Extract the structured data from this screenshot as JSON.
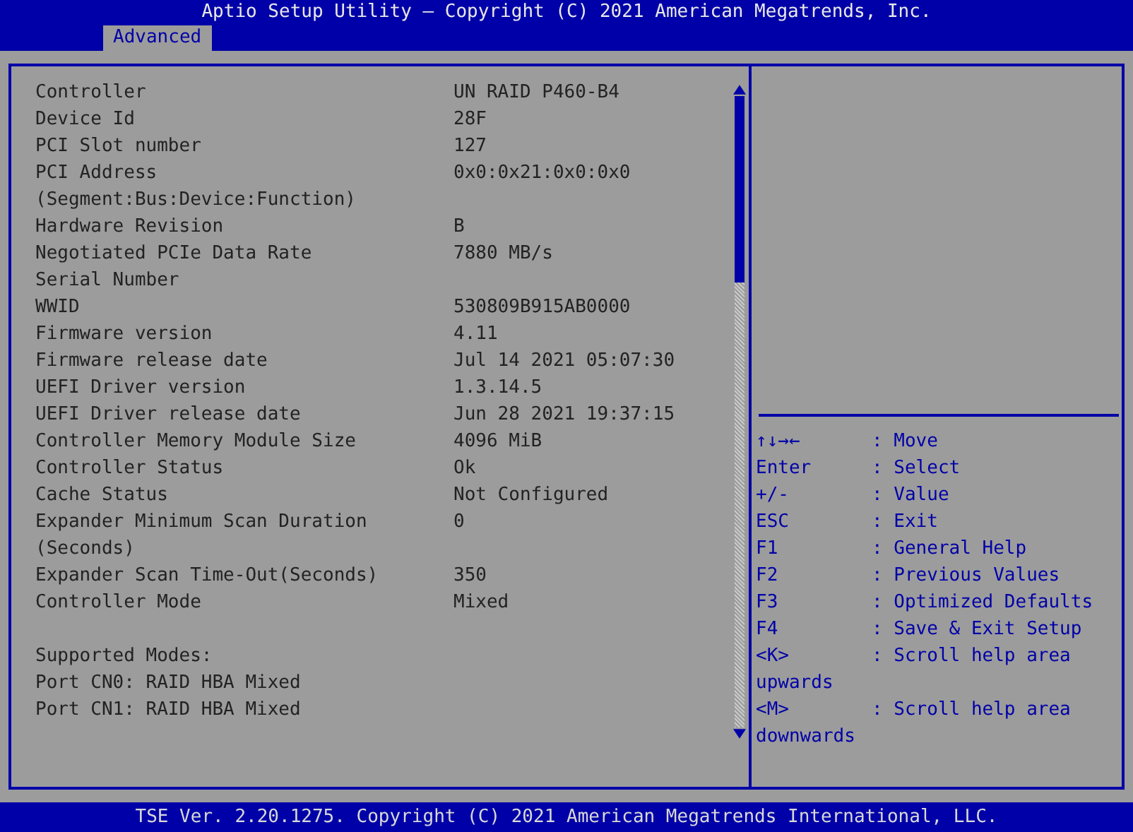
{
  "window": {
    "title": "Aptio Setup Utility – Copyright (C) 2021 American Megatrends, Inc."
  },
  "tabs": [
    {
      "label": "Advanced",
      "selected": true
    }
  ],
  "fields": [
    {
      "label": "Controller",
      "value": "UN RAID P460-B4"
    },
    {
      "label": "Device Id",
      "value": "28F"
    },
    {
      "label": "PCI Slot number",
      "value": "127"
    },
    {
      "label": "PCI Address",
      "value": "0x0:0x21:0x0:0x0"
    },
    {
      "label": "(Segment:Bus:Device:Function)"
    },
    {
      "label": "Hardware Revision",
      "value": "B"
    },
    {
      "label": "Negotiated PCIe Data Rate",
      "value": "7880 MB/s"
    },
    {
      "label": "Serial Number"
    },
    {
      "label": "WWID",
      "value": "530809B915AB0000"
    },
    {
      "label": "Firmware version",
      "value": "4.11"
    },
    {
      "label": "Firmware release date",
      "value": "Jul 14 2021 05:07:30"
    },
    {
      "label": "UEFI Driver version",
      "value": "1.3.14.5"
    },
    {
      "label": "UEFI Driver release date",
      "value": "Jun 28 2021 19:37:15"
    },
    {
      "label": "Controller Memory Module Size",
      "value": "4096 MiB"
    },
    {
      "label": "Controller Status",
      "value": "Ok"
    },
    {
      "label": "Cache Status",
      "value": "Not Configured"
    },
    {
      "label": "Expander Minimum Scan Duration",
      "value": "0"
    },
    {
      "label": "(Seconds)"
    },
    {
      "label": "Expander Scan Time-Out(Seconds)",
      "value": "350"
    },
    {
      "label": "Controller Mode",
      "value": "Mixed"
    }
  ],
  "notes": [
    "Supported Modes:",
    "Port CN0: RAID HBA Mixed",
    "Port CN1: RAID HBA Mixed"
  ],
  "help": [
    {
      "key": "↑↓→←",
      "action": ": Move"
    },
    {
      "key": "Enter",
      "action": ": Select"
    },
    {
      "key": "+/-",
      "action": ": Value"
    },
    {
      "key": "ESC",
      "action": ": Exit"
    },
    {
      "key": "F1",
      "action": ": General Help"
    },
    {
      "key": "F2",
      "action": ": Previous Values"
    },
    {
      "key": "F3",
      "action": ": Optimized Defaults"
    },
    {
      "key": "F4",
      "action": ": Save & Exit Setup"
    },
    {
      "key": "<K>",
      "action": ": Scroll help area",
      "wrap": "upwards"
    },
    {
      "key": "<M>",
      "action": ": Scroll help area",
      "wrap": "downwards"
    }
  ],
  "status_bar": "TSE Ver. 2.20.1275. Copyright (C) 2021 American Megatrends International, LLC."
}
